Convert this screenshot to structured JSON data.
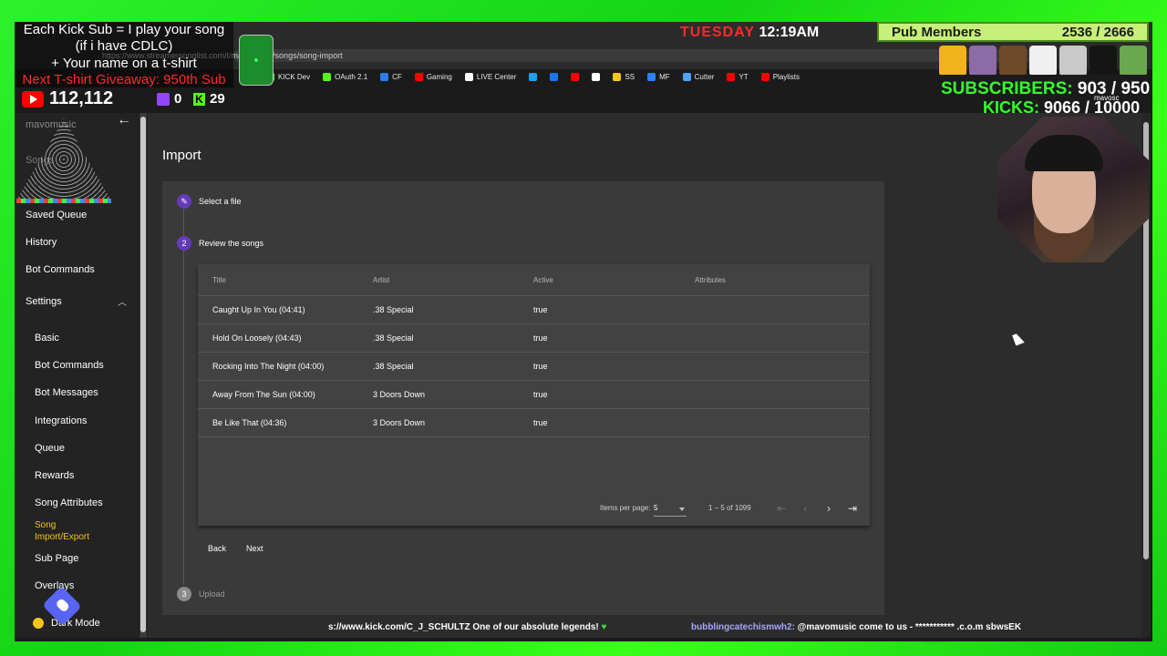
{
  "overlay": {
    "promo_lines": [
      "Each Kick Sub = I play your song",
      "(if i have CDLC)",
      "+ Your name on a t-shirt",
      "Next T-shirt Giveaway: 950th Sub"
    ],
    "youtube_count": "112,112",
    "twitch_count": "0",
    "kick_count": "29",
    "day": "TUESDAY",
    "time": "12:19AM",
    "pub_members_label": "Pub Members",
    "pub_members_value": "2536 / 2666",
    "subscribers_label": "SUBSCRIBERS:",
    "subscribers_value": "903 / 950",
    "kicks_label": "KICKS:",
    "kicks_value": "9066 / 10000",
    "handle": "mavosc",
    "ticker_left": "s://www.kick.com/C_J_SCHULTZ One of our absolute legends!",
    "ticker_user": "bubblingcatechismwh2:",
    "ticker_right": " @mavomusic come to us - *********** .c.o.m sbwsEK",
    "colors": {
      "kick_green": "#53fc18",
      "youtube_red": "#ff0000",
      "twitch_purple": "#9146ff",
      "day_red": "#ff2a2a",
      "sub_green": "#35ff2b"
    }
  },
  "browser": {
    "address": "https://www.streamersonglist.com/t/mavomusic/songs/song-import",
    "bookmarks": [
      {
        "label": "KICK Dev",
        "icon": "kick-icon",
        "color": "#53fc18"
      },
      {
        "label": "OAuth 2.1",
        "icon": "kick-icon",
        "color": "#53fc18"
      },
      {
        "label": "CF",
        "icon": "bookmark-icon",
        "color": "#2a7fff"
      },
      {
        "label": "Gaming",
        "icon": "youtube-icon",
        "color": "#ff0000"
      },
      {
        "label": "LIVE Center",
        "icon": "tiktok-icon",
        "color": "#ffffff"
      },
      {
        "label": "",
        "icon": "skype-icon",
        "color": "#1da1f2"
      },
      {
        "label": "",
        "icon": "facebook-icon",
        "color": "#1877f2"
      },
      {
        "label": "",
        "icon": "youtube-icon",
        "color": "#ff0000"
      },
      {
        "label": "",
        "icon": "x-icon",
        "color": "#ffffff"
      },
      {
        "label": "SS",
        "icon": "bookmark-icon",
        "color": "#f5c518"
      },
      {
        "label": "MF",
        "icon": "bookmark-icon",
        "color": "#2a7fff"
      },
      {
        "label": "Cutter",
        "icon": "cutter-icon",
        "color": "#4da3ff"
      },
      {
        "label": "YT",
        "icon": "youtube-icon",
        "color": "#ff0000"
      },
      {
        "label": "Playlists",
        "icon": "youtube-icon",
        "color": "#ff0000"
      }
    ]
  },
  "sidebar": {
    "faded_top_label": "mavomusic",
    "faded_songs_label": "Songs",
    "items": [
      "Saved Queue",
      "History",
      "Bot Commands"
    ],
    "settings_label": "Settings",
    "settings_items": [
      "Basic",
      "Bot Commands",
      "Bot Messages",
      "Integrations",
      "Queue",
      "Rewards",
      "Song Attributes"
    ],
    "active_item_line1": "Song",
    "active_item_line2": "Import/Export",
    "after_items": [
      "Sub Page",
      "Overlays"
    ],
    "dark_mode_label": "Dark Mode",
    "accent_color": "#f5c518"
  },
  "page": {
    "title": "Import",
    "step1_label": "Select a file",
    "step2_number": "2",
    "step2_label": "Review the songs",
    "step3_number": "3",
    "step3_label": "Upload",
    "back_label": "Back",
    "next_label": "Next",
    "stepper_color": "#673ab7"
  },
  "table": {
    "headers": {
      "title": "Title",
      "artist": "Artist",
      "active": "Active",
      "attributes": "Attributes"
    },
    "rows": [
      {
        "title": "Caught Up In You (04:41)",
        "artist": ".38 Special",
        "active": "true",
        "attributes": ""
      },
      {
        "title": "Hold On Loosely (04:43)",
        "artist": ".38 Special",
        "active": "true",
        "attributes": ""
      },
      {
        "title": "Rocking Into The Night (04:00)",
        "artist": ".38 Special",
        "active": "true",
        "attributes": ""
      },
      {
        "title": "Away From The Sun (04:00)",
        "artist": "3 Doors Down",
        "active": "true",
        "attributes": ""
      },
      {
        "title": "Be Like That (04:36)",
        "artist": "3 Doors Down",
        "active": "true",
        "attributes": ""
      }
    ],
    "items_per_page_label": "Items per page:",
    "items_per_page_value": "5",
    "range_label": "1 – 5 of 1099"
  }
}
